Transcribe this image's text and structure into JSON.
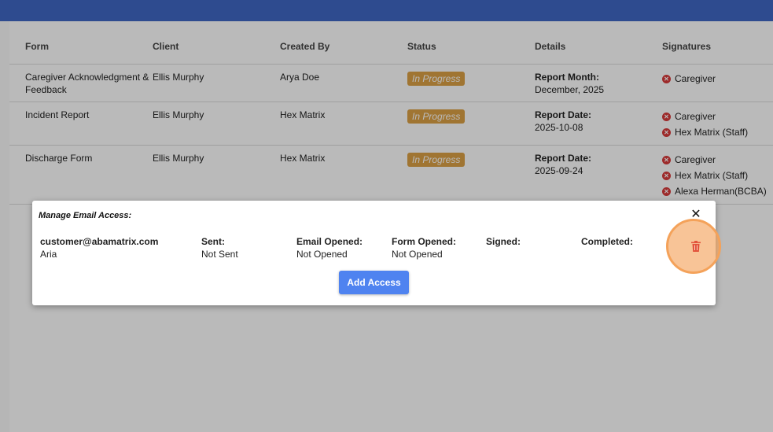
{
  "table": {
    "headers": [
      "Form",
      "Client",
      "Created By",
      "Status",
      "Details",
      "Signatures"
    ],
    "rows": [
      {
        "form": "Caregiver Acknowledgment & Feedback",
        "client": "Ellis Murphy",
        "created_by": "Arya Doe",
        "status": "In Progress",
        "details_label": "Report Month:",
        "details_value": "December, 2025",
        "signatures": [
          "Caregiver"
        ]
      },
      {
        "form": "Incident Report",
        "client": "Ellis Murphy",
        "created_by": "Hex Matrix",
        "status": "In Progress",
        "details_label": "Report Date:",
        "details_value": "2025-10-08",
        "signatures": [
          "Caregiver",
          "Hex Matrix (Staff)"
        ]
      },
      {
        "form": "Discharge Form",
        "client": "Ellis Murphy",
        "created_by": "Hex Matrix",
        "status": "In Progress",
        "details_label": "Report Date:",
        "details_value": "2025-09-24",
        "signatures": [
          "Caregiver",
          "Hex Matrix (Staff)",
          "Alexa Herman(BCBA)"
        ]
      }
    ]
  },
  "modal": {
    "title": "Manage Email Access:",
    "close_icon": "close-icon",
    "email": "customer@abamatrix.com",
    "name": "Aria",
    "sent_label": "Sent:",
    "sent_value": "Not Sent",
    "email_opened_label": "Email Opened:",
    "email_opened_value": "Not Opened",
    "form_opened_label": "Form Opened:",
    "form_opened_value": "Not Opened",
    "signed_label": "Signed:",
    "completed_label": "Completed:",
    "delete_icon": "trash-icon",
    "add_button": "Add Access"
  },
  "colors": {
    "header_bar": "#3f67c4",
    "status_badge": "#dca145",
    "signature_missing": "#d83a3a",
    "primary_button": "#4f83f0",
    "delete_icon": "#e2543c",
    "click_highlight": "#f4a25a"
  }
}
